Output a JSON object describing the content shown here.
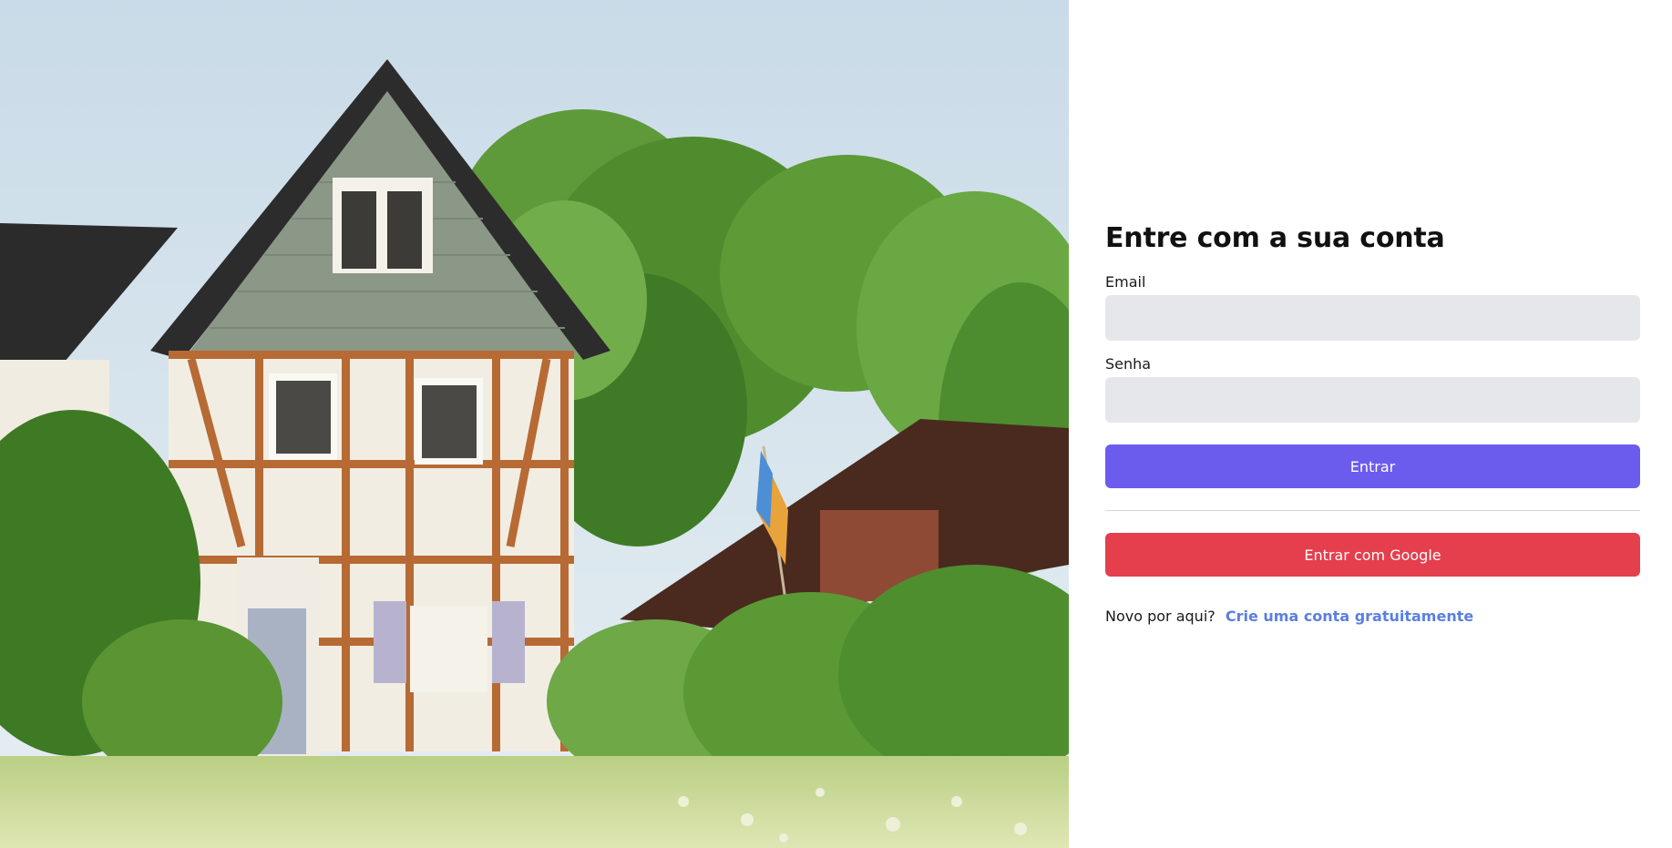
{
  "login": {
    "title": "Entre com a sua conta",
    "email_label": "Email",
    "email_value": "",
    "password_label": "Senha",
    "password_value": "",
    "submit_label": "Entrar",
    "google_label": "Entrar com Google",
    "signup_prompt": "Novo por aqui?",
    "signup_link": "Crie uma conta gratuitamente"
  },
  "colors": {
    "primary": "#6c5ced",
    "google": "#e53e4d",
    "link": "#5b7fe0",
    "input_bg": "#e6e7ea"
  },
  "hero": {
    "icon": "house-photo"
  }
}
